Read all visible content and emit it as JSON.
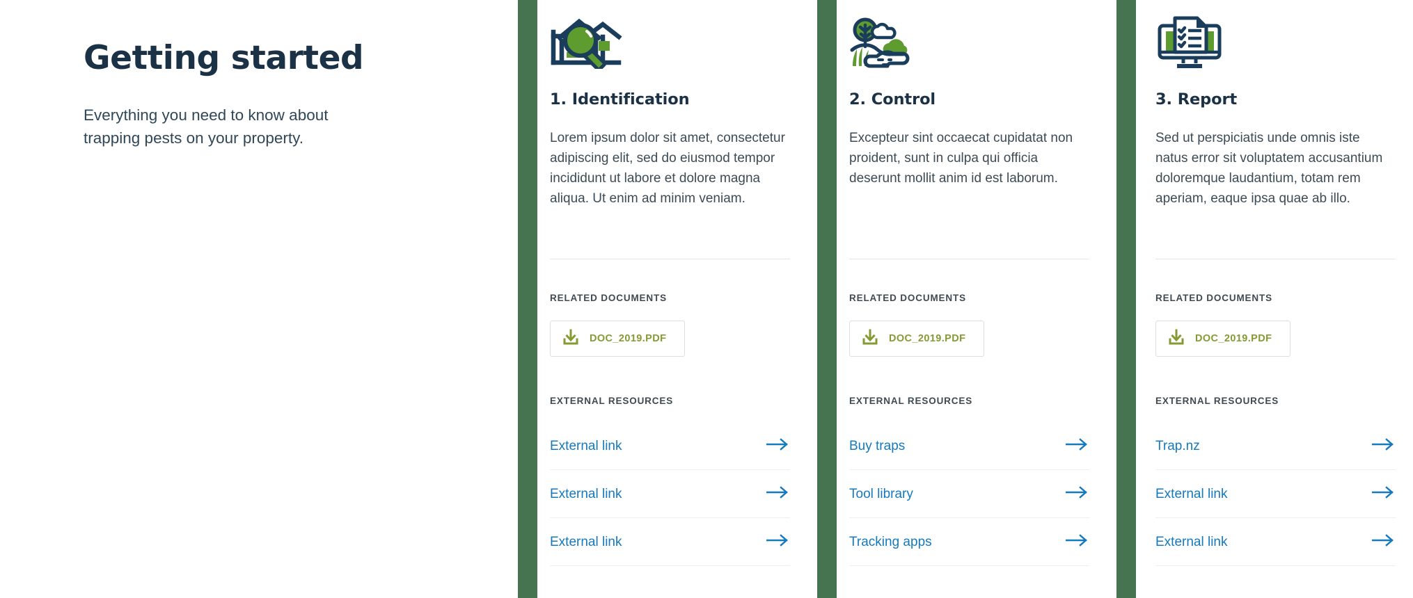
{
  "intro": {
    "title": "Getting started",
    "subtitle": "Everything you need to know about trapping pests on your property."
  },
  "colors": {
    "navy": "#1b3145",
    "bar_green": "#467350",
    "icon_green": "#5f9c2f",
    "doc_olive": "#869a33",
    "link_blue": "#1479bd",
    "divider": "#eceef0"
  },
  "section_labels": {
    "related_documents": "RELATED DOCUMENTS",
    "external_resources": "EXTERNAL RESOURCES"
  },
  "cards": [
    {
      "icon": "house-magnifier-icon",
      "title": "1. Identification",
      "text": "Lorem ipsum dolor sit amet, consectetur adipiscing elit, sed do eiusmod tempor incididunt ut labore et dolore magna aliqua. Ut enim ad minim veniam.",
      "document": {
        "icon": "download-icon",
        "name": "DOC_2019.PDF"
      },
      "links": [
        {
          "label": "External link",
          "icon": "arrow-right-icon"
        },
        {
          "label": "External link",
          "icon": "arrow-right-icon"
        },
        {
          "label": "External link",
          "icon": "arrow-right-icon"
        }
      ]
    },
    {
      "icon": "landscape-nature-icon",
      "title": "2. Control",
      "text": "Excepteur sint occaecat cupidatat non proident, sunt in culpa qui officia deserunt mollit anim id est laborum.",
      "document": {
        "icon": "download-icon",
        "name": "DOC_2019.PDF"
      },
      "links": [
        {
          "label": "Buy traps",
          "icon": "arrow-right-icon"
        },
        {
          "label": "Tool library",
          "icon": "arrow-right-icon"
        },
        {
          "label": "Tracking apps",
          "icon": "arrow-right-icon"
        }
      ]
    },
    {
      "icon": "monitor-checklist-icon",
      "title": "3. Report",
      "text": "Sed ut perspiciatis unde omnis iste natus error sit voluptatem accusantium doloremque laudantium, totam rem aperiam, eaque ipsa quae ab illo.",
      "document": {
        "icon": "download-icon",
        "name": "DOC_2019.PDF"
      },
      "links": [
        {
          "label": "Trap.nz",
          "icon": "arrow-right-icon"
        },
        {
          "label": "External link",
          "icon": "arrow-right-icon"
        },
        {
          "label": "External link",
          "icon": "arrow-right-icon"
        }
      ]
    }
  ]
}
